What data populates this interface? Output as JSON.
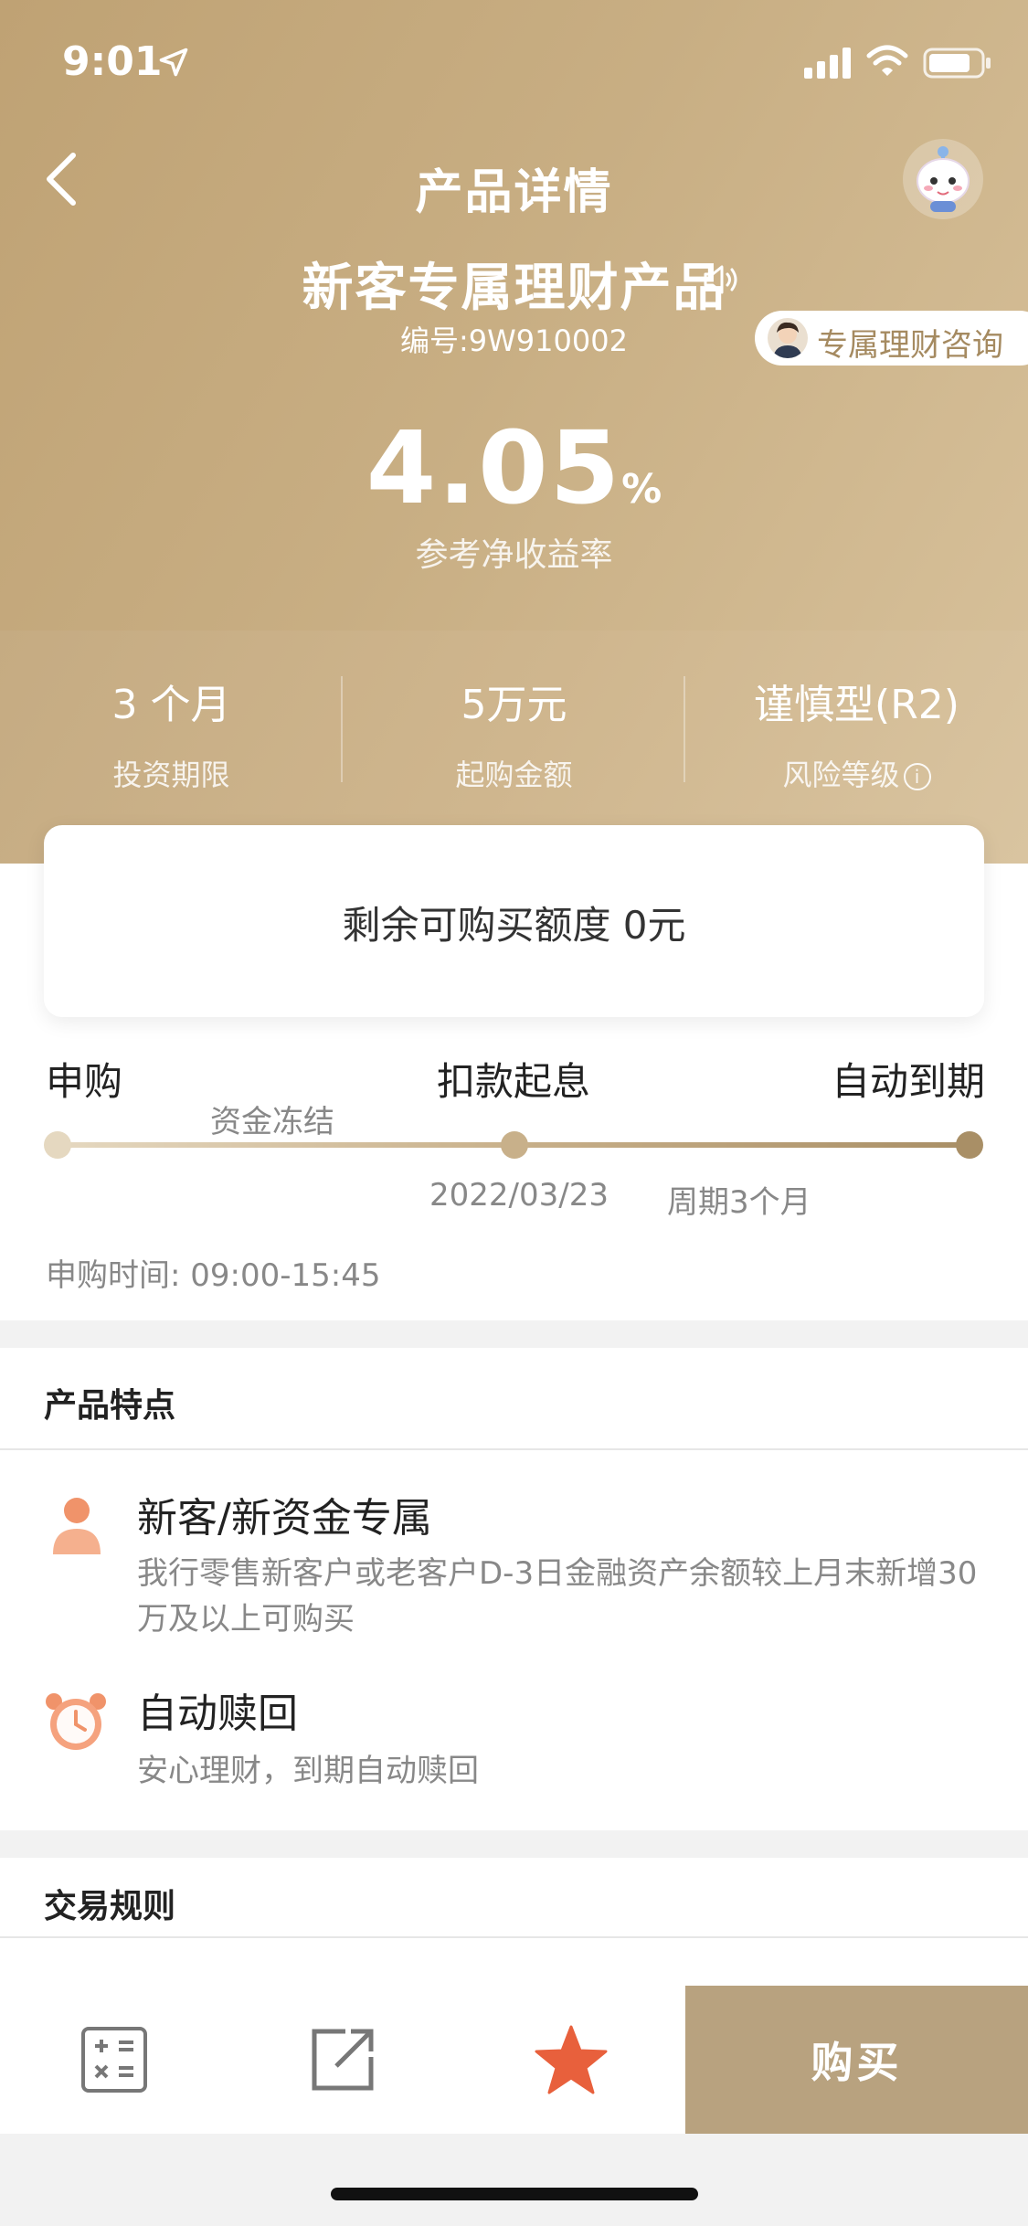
{
  "status_bar": {
    "time": "9:01"
  },
  "header": {
    "title": "产品详情"
  },
  "product": {
    "name": "新客专属理财产品",
    "code": "编号:9W910002",
    "rate": "4.05",
    "rate_unit": "%",
    "rate_label": "参考净收益率"
  },
  "consult": {
    "label": "专属理财咨询"
  },
  "meta": [
    {
      "value": "3 个月",
      "label": "投资期限"
    },
    {
      "value": "5万元",
      "label": "起购金额"
    },
    {
      "value": "谨慎型(R2)",
      "label": "风险等级"
    }
  ],
  "quota": {
    "text": "剩余可购买额度 0元"
  },
  "timeline": {
    "steps": [
      "申购",
      "扣款起息",
      "自动到期"
    ],
    "freeze_label": "资金冻结",
    "date": "2022/03/23",
    "period": "周期3个月",
    "purchase_time": "申购时间: 09:00-15:45"
  },
  "features": {
    "title": "产品特点",
    "items": [
      {
        "title": "新客/新资金专属",
        "desc": "我行零售新客户或老客户D-3日金融资产余额较上月末新增30万及以上可购买"
      },
      {
        "title": "自动赎回",
        "desc": "安心理财，到期自动赎回"
      }
    ]
  },
  "rules": {
    "title": "交易规则"
  },
  "bottom_bar": {
    "buy_label": "购买"
  },
  "colors": {
    "accent": "#b8a27f",
    "hero": "#c8ae83",
    "star": "#e8603c",
    "feature_icon": "#f0936a"
  }
}
